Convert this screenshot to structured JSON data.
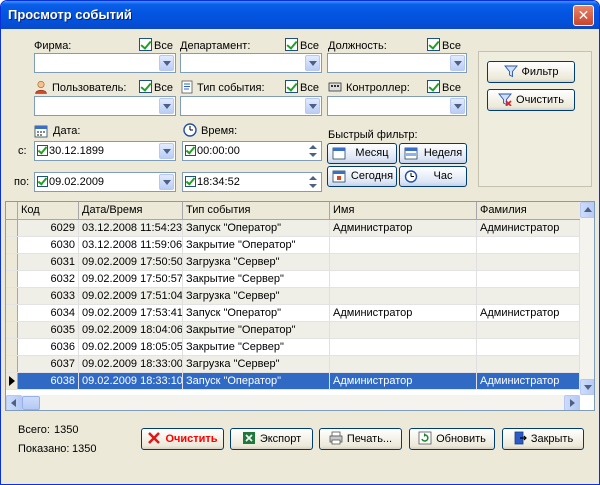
{
  "window": {
    "title": "Просмотр событий",
    "close_glyph": "✕"
  },
  "filters": {
    "all_label": "Все",
    "firm_label": "Фирма:",
    "department_label": "Департамент:",
    "position_label": "Должность:",
    "user_label": "Пользователь:",
    "event_type_label": "Тип события:",
    "controller_label": "Контроллер:",
    "date_label": "Дата:",
    "time_label": "Время:",
    "from_label": "с:",
    "to_label": "по:",
    "date_from": "30.12.1899",
    "date_to": "09.02.2009",
    "time_from": "00:00:00",
    "time_to": "18:34:52",
    "quick_filter_label": "Быстрый фильтр:",
    "quick": {
      "month": "Месяц",
      "week": "Неделя",
      "today": "Сегодня",
      "hour": "Час"
    }
  },
  "side": {
    "filter_button": "Фильтр",
    "clear_button": "Очистить"
  },
  "grid": {
    "columns": [
      "Код",
      "Дата/Время",
      "Тип события",
      "Имя",
      "Фамилия"
    ],
    "rows": [
      [
        "6029",
        "03.12.2008 11:54:23",
        "Запуск \"Оператор\"",
        "Администратор",
        "Администратор"
      ],
      [
        "6030",
        "03.12.2008 11:59:06",
        "Закрытие \"Оператор\"",
        "",
        ""
      ],
      [
        "6031",
        "09.02.2009 17:50:50",
        "Загрузка \"Сервер\"",
        "",
        ""
      ],
      [
        "6032",
        "09.02.2009 17:50:57",
        "Закрытие \"Сервер\"",
        "",
        ""
      ],
      [
        "6033",
        "09.02.2009 17:51:04",
        "Загрузка \"Сервер\"",
        "",
        ""
      ],
      [
        "6034",
        "09.02.2009 17:53:41",
        "Запуск \"Оператор\"",
        "Администратор",
        "Администратор"
      ],
      [
        "6035",
        "09.02.2009 18:04:06",
        "Закрытие \"Оператор\"",
        "",
        ""
      ],
      [
        "6036",
        "09.02.2009 18:05:05",
        "Закрытие \"Сервер\"",
        "",
        ""
      ],
      [
        "6037",
        "09.02.2009 18:33:00",
        "Загрузка \"Сервер\"",
        "",
        ""
      ],
      [
        "6038",
        "09.02.2009 18:33:10",
        "Запуск \"Оператор\"",
        "Администратор",
        "Администратор"
      ]
    ],
    "selected_row": 9
  },
  "footer": {
    "total_label": "Всего:",
    "total_value": "1350",
    "shown_label": "Показано:",
    "shown_value": "1350",
    "clear_button": "Очистить",
    "export_button": "Экспорт",
    "print_button": "Печать...",
    "refresh_button": "Обновить",
    "close_button": "Закрыть"
  },
  "colors": {
    "selection": "#316ac5",
    "alt_row": "#efefe7",
    "clear_text": "#ff0000",
    "titlebar": "#0454e2"
  }
}
